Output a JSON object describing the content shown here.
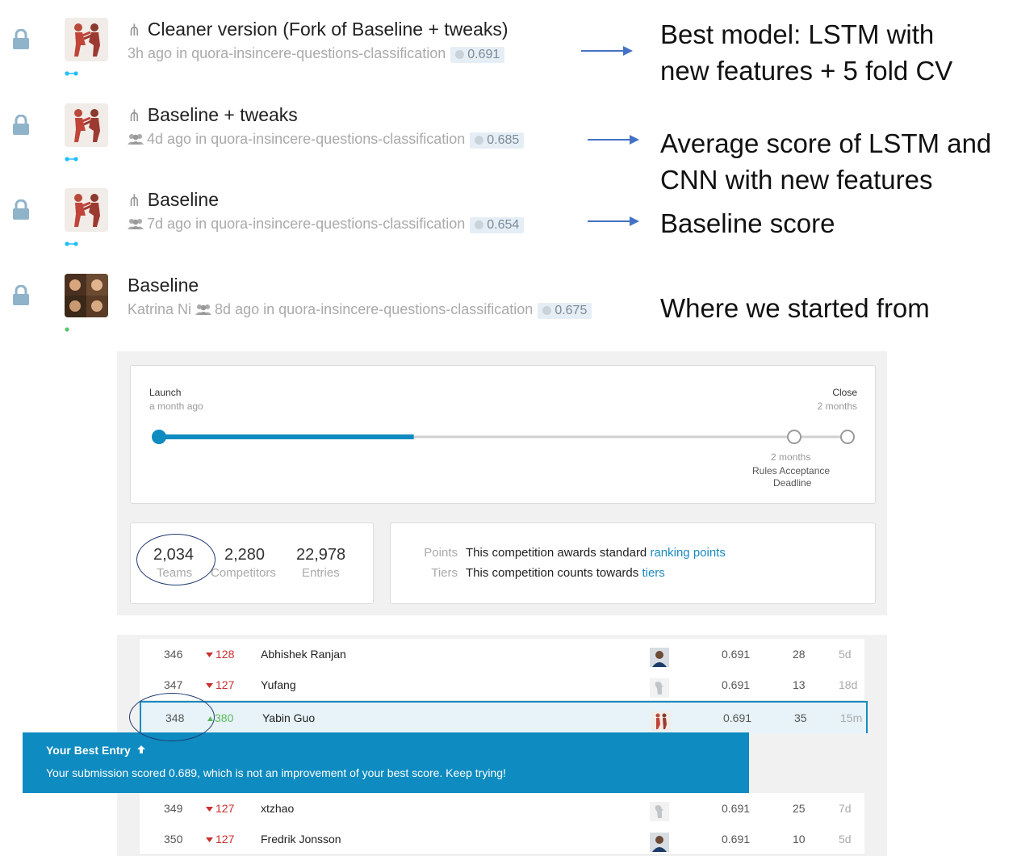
{
  "kernels": [
    {
      "title": "Cleaner version (Fork of Baseline + tweaks)",
      "forked": true,
      "team": false,
      "author": "",
      "age": "3h ago",
      "in_word": "in",
      "competition": "quora-insincere-questions-classification",
      "score": "0.691",
      "note": [
        "Best model: LSTM with",
        "new features + 5 fold CV"
      ]
    },
    {
      "title": "Baseline + tweaks",
      "forked": true,
      "team": true,
      "author": "",
      "age": "4d ago",
      "in_word": "in",
      "competition": "quora-insincere-questions-classification",
      "score": "0.685",
      "note": [
        "Average score of LSTM and",
        "CNN with new features"
      ]
    },
    {
      "title": "Baseline",
      "forked": true,
      "team": true,
      "author": "",
      "age": "7d ago",
      "in_word": "in",
      "competition": "quora-insincere-questions-classification",
      "score": "0.654",
      "note": [
        "Baseline score"
      ]
    },
    {
      "title": "Baseline",
      "forked": false,
      "team": true,
      "author": "Katrina Ni",
      "age": "8d ago",
      "in_word": "in",
      "competition": "quora-insincere-questions-classification",
      "score": "0.675",
      "note": [
        "Where we started from"
      ]
    }
  ],
  "timeline": {
    "launch_label": "Launch",
    "launch_sub": "a month ago",
    "close_label": "Close",
    "close_sub": "2 months",
    "milestone_sub": "2 months",
    "milestone_label": "Rules Acceptance",
    "milestone_label2": "Deadline",
    "progress_fraction": 0.37
  },
  "stats": [
    {
      "value": "2,034",
      "label": "Teams"
    },
    {
      "value": "2,280",
      "label": "Competitors"
    },
    {
      "value": "22,978",
      "label": "Entries"
    }
  ],
  "info": {
    "points_key": "Points",
    "points_text": "This competition awards standard ",
    "points_link": "ranking points",
    "tiers_key": "Tiers",
    "tiers_text": "This competition counts towards ",
    "tiers_link": "tiers"
  },
  "leaderboard": [
    {
      "rank": "346",
      "delta": "128",
      "dir": "down",
      "name": "Abhishek Ranjan",
      "score": "0.691",
      "entries": "28",
      "last": "5d",
      "avatar": "person"
    },
    {
      "rank": "347",
      "delta": "127",
      "dir": "down",
      "name": "Yufang",
      "score": "0.691",
      "entries": "13",
      "last": "18d",
      "avatar": "bird"
    },
    {
      "rank": "348",
      "delta": "380",
      "dir": "up",
      "name": "Yabin Guo",
      "score": "0.691",
      "entries": "35",
      "last": "15m",
      "avatar": "fight"
    },
    {
      "rank": "349",
      "delta": "127",
      "dir": "down",
      "name": "xtzhao",
      "score": "0.691",
      "entries": "25",
      "last": "7d",
      "avatar": "bird"
    },
    {
      "rank": "350",
      "delta": "127",
      "dir": "down",
      "name": "Fredrik Jonsson",
      "score": "0.691",
      "entries": "10",
      "last": "5d",
      "avatar": "person"
    }
  ],
  "best_entry": {
    "title": "Your Best Entry",
    "message": "Your submission scored 0.689, which is not an improvement of your best score. Keep trying!"
  },
  "colors": {
    "accent": "#0e8bc0",
    "arrow": "#4472c4",
    "down": "#c9302c",
    "up": "#5cb85c",
    "lock": "#8fb3c9"
  },
  "icons": [
    "lock-icon",
    "fork-icon",
    "team-icon",
    "score-medal-icon",
    "arrow-up-icon"
  ]
}
